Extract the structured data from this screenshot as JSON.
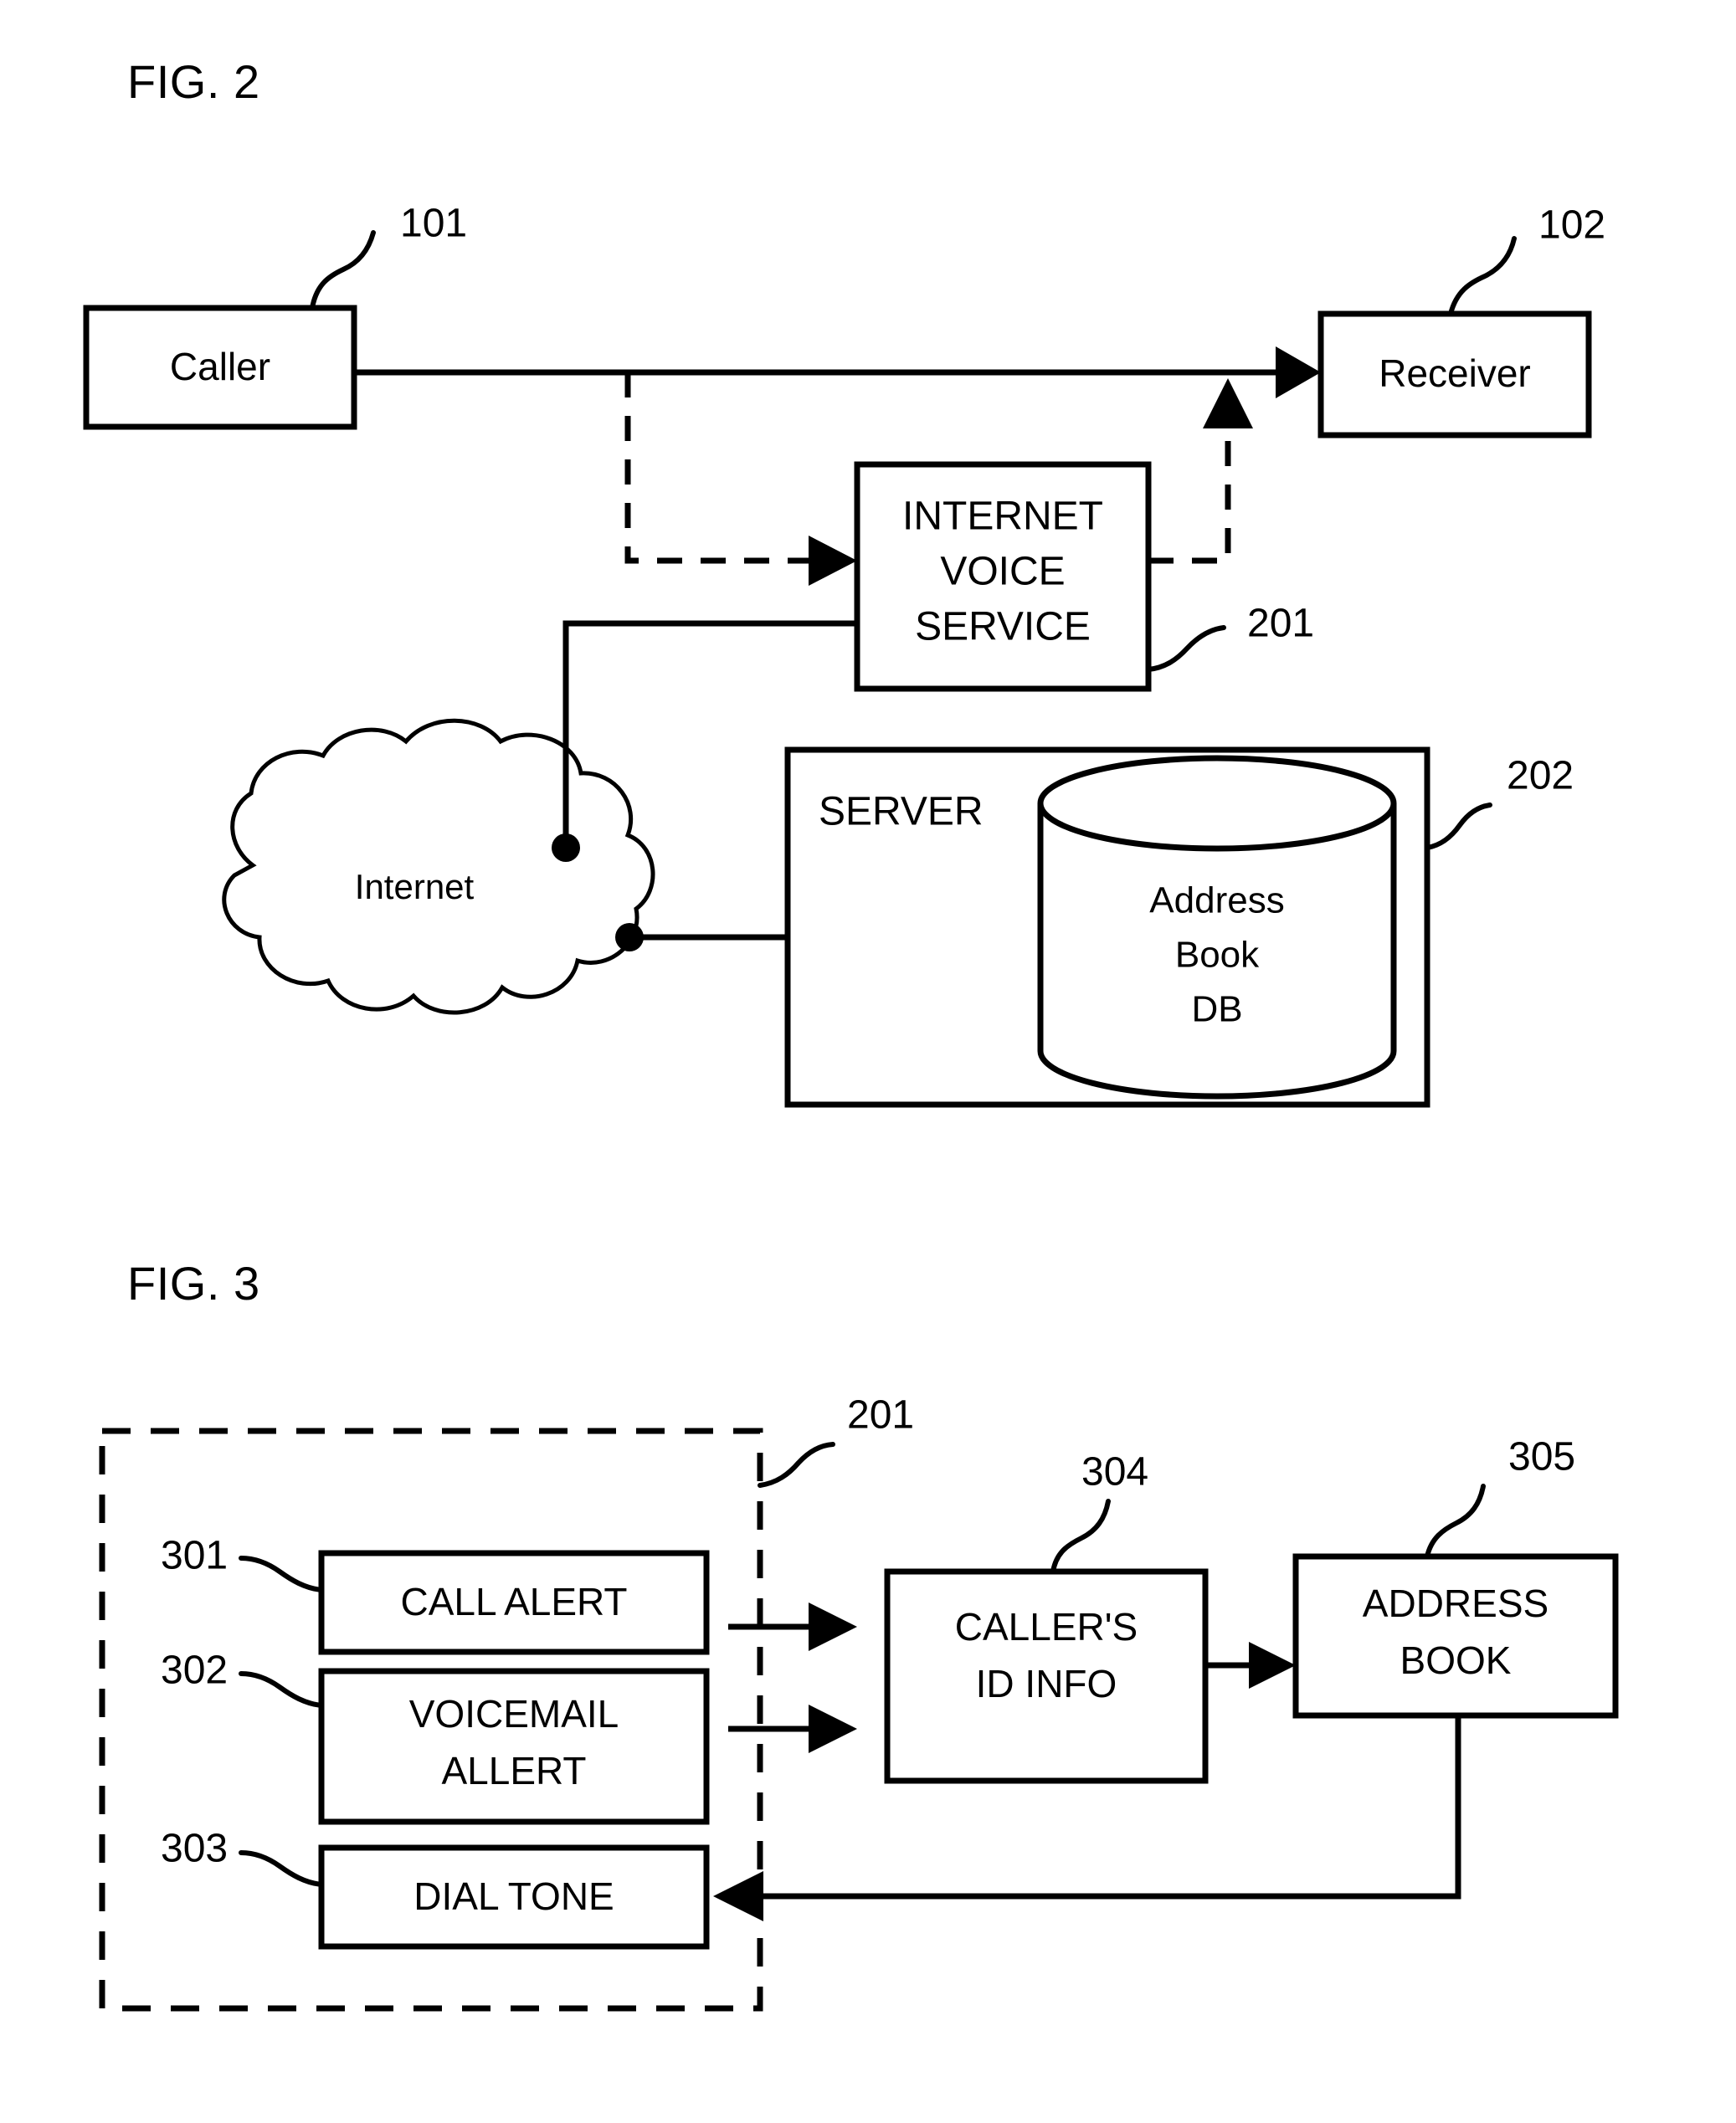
{
  "document": {
    "type": "patent-drawing-sheet",
    "figures": [
      {
        "id": "fig2",
        "title": "FIG. 2",
        "nodes": [
          {
            "id": "caller",
            "label": "Caller",
            "ref": "101"
          },
          {
            "id": "receiver",
            "label": "Receiver",
            "ref": "102"
          },
          {
            "id": "ivs",
            "label": "INTERNET\nVOICE\nSERVICE",
            "ref": "201",
            "lines": [
              "INTERNET",
              "VOICE",
              "SERVICE"
            ]
          },
          {
            "id": "server",
            "label": "SERVER",
            "ref": "202"
          },
          {
            "id": "db",
            "label": "Address\nBook\nDB",
            "ref": "",
            "lines": [
              "Address",
              "Book",
              "DB"
            ]
          },
          {
            "id": "internet",
            "label": "Internet",
            "ref": ""
          }
        ],
        "edges": [
          {
            "from": "caller",
            "to": "receiver",
            "style": "solid",
            "arrow": true
          },
          {
            "from": "caller",
            "to": "ivs",
            "style": "dashed",
            "arrow": true
          },
          {
            "from": "ivs",
            "to": "receiver",
            "style": "dashed",
            "arrow": true
          },
          {
            "from": "ivs",
            "to": "internet",
            "style": "solid",
            "arrow": false
          },
          {
            "from": "internet",
            "to": "server",
            "style": "solid",
            "arrow": false
          }
        ]
      },
      {
        "id": "fig3",
        "title": "FIG. 3",
        "group": {
          "label": "",
          "ref": "201",
          "style": "dashed"
        },
        "nodes": [
          {
            "id": "call_alert",
            "label": "CALL ALERT",
            "ref": "301",
            "lines": [
              "CALL ALERT"
            ]
          },
          {
            "id": "voicemail_alert",
            "label": "VOICEMAIL ALLERT",
            "ref": "302",
            "lines": [
              "VOICEMAIL",
              "ALLERT"
            ]
          },
          {
            "id": "dial_tone",
            "label": "DIAL TONE",
            "ref": "303",
            "lines": [
              "DIAL TONE"
            ]
          },
          {
            "id": "callers_id_info",
            "label": "CALLER'S ID INFO",
            "ref": "304",
            "lines": [
              "CALLER'S",
              "ID INFO"
            ]
          },
          {
            "id": "address_book",
            "label": "ADDRESS BOOK",
            "ref": "305",
            "lines": [
              "ADDRESS",
              "BOOK"
            ]
          }
        ],
        "edges": [
          {
            "from": "call_alert",
            "to": "callers_id_info",
            "style": "solid",
            "arrow": true
          },
          {
            "from": "voicemail_alert",
            "to": "callers_id_info",
            "style": "solid",
            "arrow": true
          },
          {
            "from": "callers_id_info",
            "to": "address_book",
            "style": "solid",
            "arrow": true
          },
          {
            "from": "address_book",
            "to": "dial_tone",
            "style": "solid",
            "arrow": true
          }
        ]
      }
    ]
  },
  "fig2": {
    "title": "FIG. 2",
    "caller_label": "Caller",
    "caller_ref": "101",
    "receiver_label": "Receiver",
    "receiver_ref": "102",
    "ivs_line1": "INTERNET",
    "ivs_line2": "VOICE",
    "ivs_line3": "SERVICE",
    "ivs_ref": "201",
    "server_label": "SERVER",
    "server_ref": "202",
    "db_line1": "Address",
    "db_line2": "Book",
    "db_line3": "DB",
    "internet_label": "Internet"
  },
  "fig3": {
    "title": "FIG. 3",
    "group_ref": "201",
    "call_alert_label": "CALL ALERT",
    "call_alert_ref": "301",
    "voicemail_line1": "VOICEMAIL",
    "voicemail_line2": "ALLERT",
    "voicemail_ref": "302",
    "dial_tone_label": "DIAL TONE",
    "dial_tone_ref": "303",
    "callers_id_line1": "CALLER'S",
    "callers_id_line2": "ID INFO",
    "callers_id_ref": "304",
    "address_book_line1": "ADDRESS",
    "address_book_line2": "BOOK",
    "address_book_ref": "305"
  },
  "colors": {
    "ink": "#000000",
    "paper": "#ffffff"
  }
}
